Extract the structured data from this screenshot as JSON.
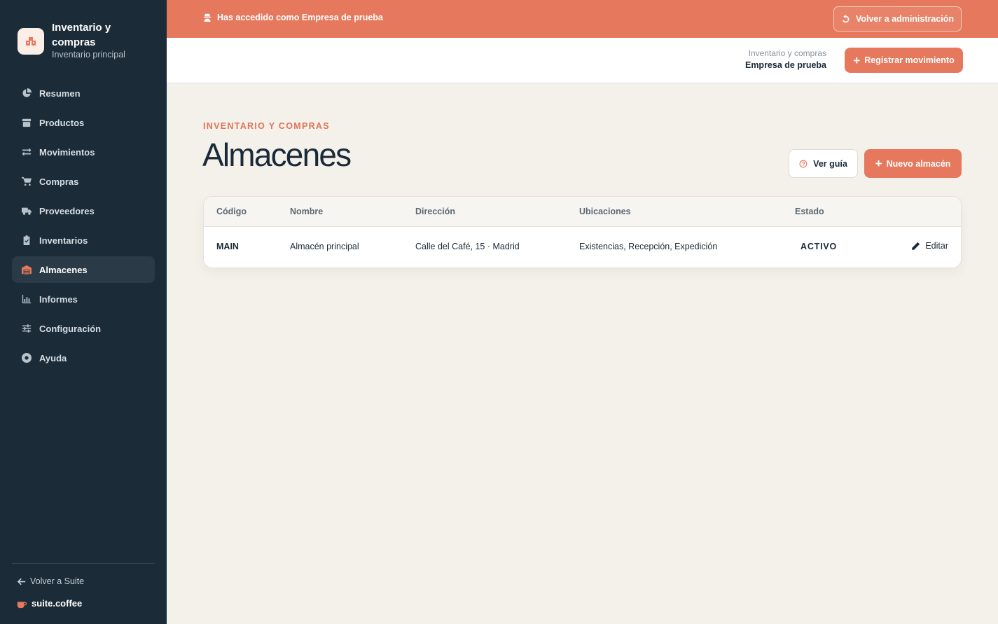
{
  "sidebar": {
    "brand_title": "Inventario y compras",
    "brand_subtitle": "Inventario principal",
    "items": [
      {
        "label": "Resumen",
        "icon": "pie-chart-icon"
      },
      {
        "label": "Productos",
        "icon": "box-icon"
      },
      {
        "label": "Movimientos",
        "icon": "swap-arrows-icon"
      },
      {
        "label": "Compras",
        "icon": "cart-icon"
      },
      {
        "label": "Proveedores",
        "icon": "truck-icon"
      },
      {
        "label": "Inventarios",
        "icon": "clipboard-check-icon"
      },
      {
        "label": "Almacenes",
        "icon": "warehouse-icon",
        "active": true
      },
      {
        "label": "Informes",
        "icon": "bar-chart-icon"
      },
      {
        "label": "Configuración",
        "icon": "sliders-icon"
      },
      {
        "label": "Ayuda",
        "icon": "lifebuoy-icon"
      }
    ],
    "back_label": "Volver a Suite",
    "suite_brand": "suite.coffee"
  },
  "banner": {
    "message": "Has accedido como Empresa de prueba",
    "back_admin_label": "Volver a administración"
  },
  "header": {
    "app_name": "Inventario y compras",
    "company": "Empresa de prueba",
    "register_label": "Registrar movimiento"
  },
  "main": {
    "eyebrow": "INVENTARIO Y COMPRAS",
    "title": "Almacenes",
    "guide_label": "Ver guía",
    "new_label": "Nuevo almacén"
  },
  "table": {
    "columns": [
      "Código",
      "Nombre",
      "Dirección",
      "Ubicaciones",
      "Estado"
    ],
    "rows": [
      {
        "code": "MAIN",
        "name": "Almacén principal",
        "address": "Calle del Café, 15 · Madrid",
        "locations": "Existencias, Recepción, Expedición",
        "status": "ACTIVO",
        "edit_label": "Editar"
      }
    ]
  },
  "colors": {
    "accent": "#e6795d",
    "sidebar_bg": "#1b2b38",
    "page_bg": "#f4f1eb"
  }
}
